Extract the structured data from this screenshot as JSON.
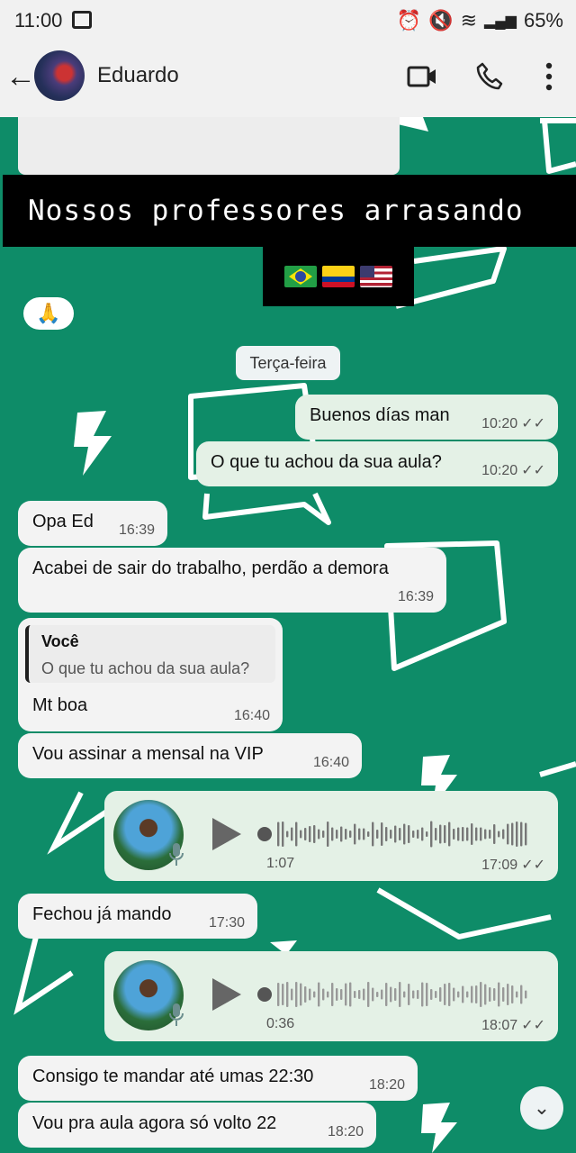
{
  "status_bar": {
    "time": "11:00",
    "battery": "65%"
  },
  "header": {
    "contact_name": "Eduardo"
  },
  "overlay": {
    "banner_text": "Nossos professores arrasando"
  },
  "date_chip": "Terça-feira",
  "messages": [
    {
      "dir": "out",
      "text": "Buenos días man",
      "time": "10:20",
      "status": "read"
    },
    {
      "dir": "out",
      "text": "O que tu achou da sua aula?",
      "time": "10:20",
      "status": "read"
    },
    {
      "dir": "in",
      "text": "Opa Ed",
      "time": "16:39"
    },
    {
      "dir": "in",
      "text": "Acabei de sair do trabalho, perdão a demora",
      "time": "16:39"
    },
    {
      "dir": "in",
      "quote_author": "Você",
      "quote_text": "O que tu achou da sua aula?",
      "text": "Mt boa",
      "time": "16:40"
    },
    {
      "dir": "in",
      "text": "Vou assinar a mensal na VIP",
      "time": "16:40"
    },
    {
      "dir": "out",
      "type": "voice",
      "duration": "1:07",
      "time": "17:09",
      "status": "read"
    },
    {
      "dir": "in",
      "text": "Fechou já mando",
      "time": "17:30"
    },
    {
      "dir": "out",
      "type": "voice",
      "duration": "0:36",
      "time": "18:07",
      "status": "read"
    },
    {
      "dir": "in",
      "text": "Consigo te mandar até umas 22:30",
      "time": "18:20"
    },
    {
      "dir": "in",
      "text": "Vou pra aula agora só volto 22",
      "time": "18:20"
    }
  ],
  "colors": {
    "chat_bg": "#0e8c68",
    "incoming": "#f3f3f3",
    "outgoing": "#e4f1e6",
    "header": "#f1f1f1"
  }
}
